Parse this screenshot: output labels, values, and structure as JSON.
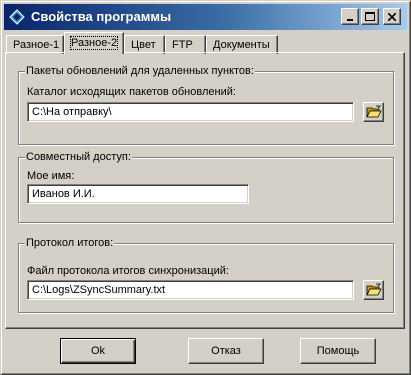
{
  "window": {
    "title": "Свойства программы",
    "icon": "diamond-app-icon",
    "controls": {
      "minimize": "minimize-icon",
      "maximize": "maximize-icon",
      "close": "close-icon"
    }
  },
  "tabs": [
    {
      "label": "Разное-1",
      "active": false
    },
    {
      "label": "Разное-2",
      "active": true
    },
    {
      "label": "Цвет",
      "active": false
    },
    {
      "label": "FTP",
      "active": false
    },
    {
      "label": "Документы",
      "active": false
    }
  ],
  "groups": {
    "updates": {
      "title": "Пакеты обновлений для удаленных пунктов:",
      "field_label": "Каталог исходящих пакетов обновлений:",
      "field_value": "C:\\На отправку\\"
    },
    "shared": {
      "title": "Совместный доступ:",
      "field_label": "Мое имя:",
      "field_value": "Иванов И.И."
    },
    "summary": {
      "title": "Протокол итогов:",
      "field_label": "Файл протокола итогов синхронизаций:",
      "field_value": "C:\\Logs\\ZSyncSummary.txt"
    }
  },
  "buttons": {
    "ok": "Ok",
    "cancel": "Отказ",
    "help": "Помощь"
  },
  "icons": {
    "browse": "folder-open-icon"
  },
  "colors": {
    "titlebar_start": "#0a246a",
    "titlebar_end": "#a6caf0",
    "face": "#d4d0c8"
  }
}
